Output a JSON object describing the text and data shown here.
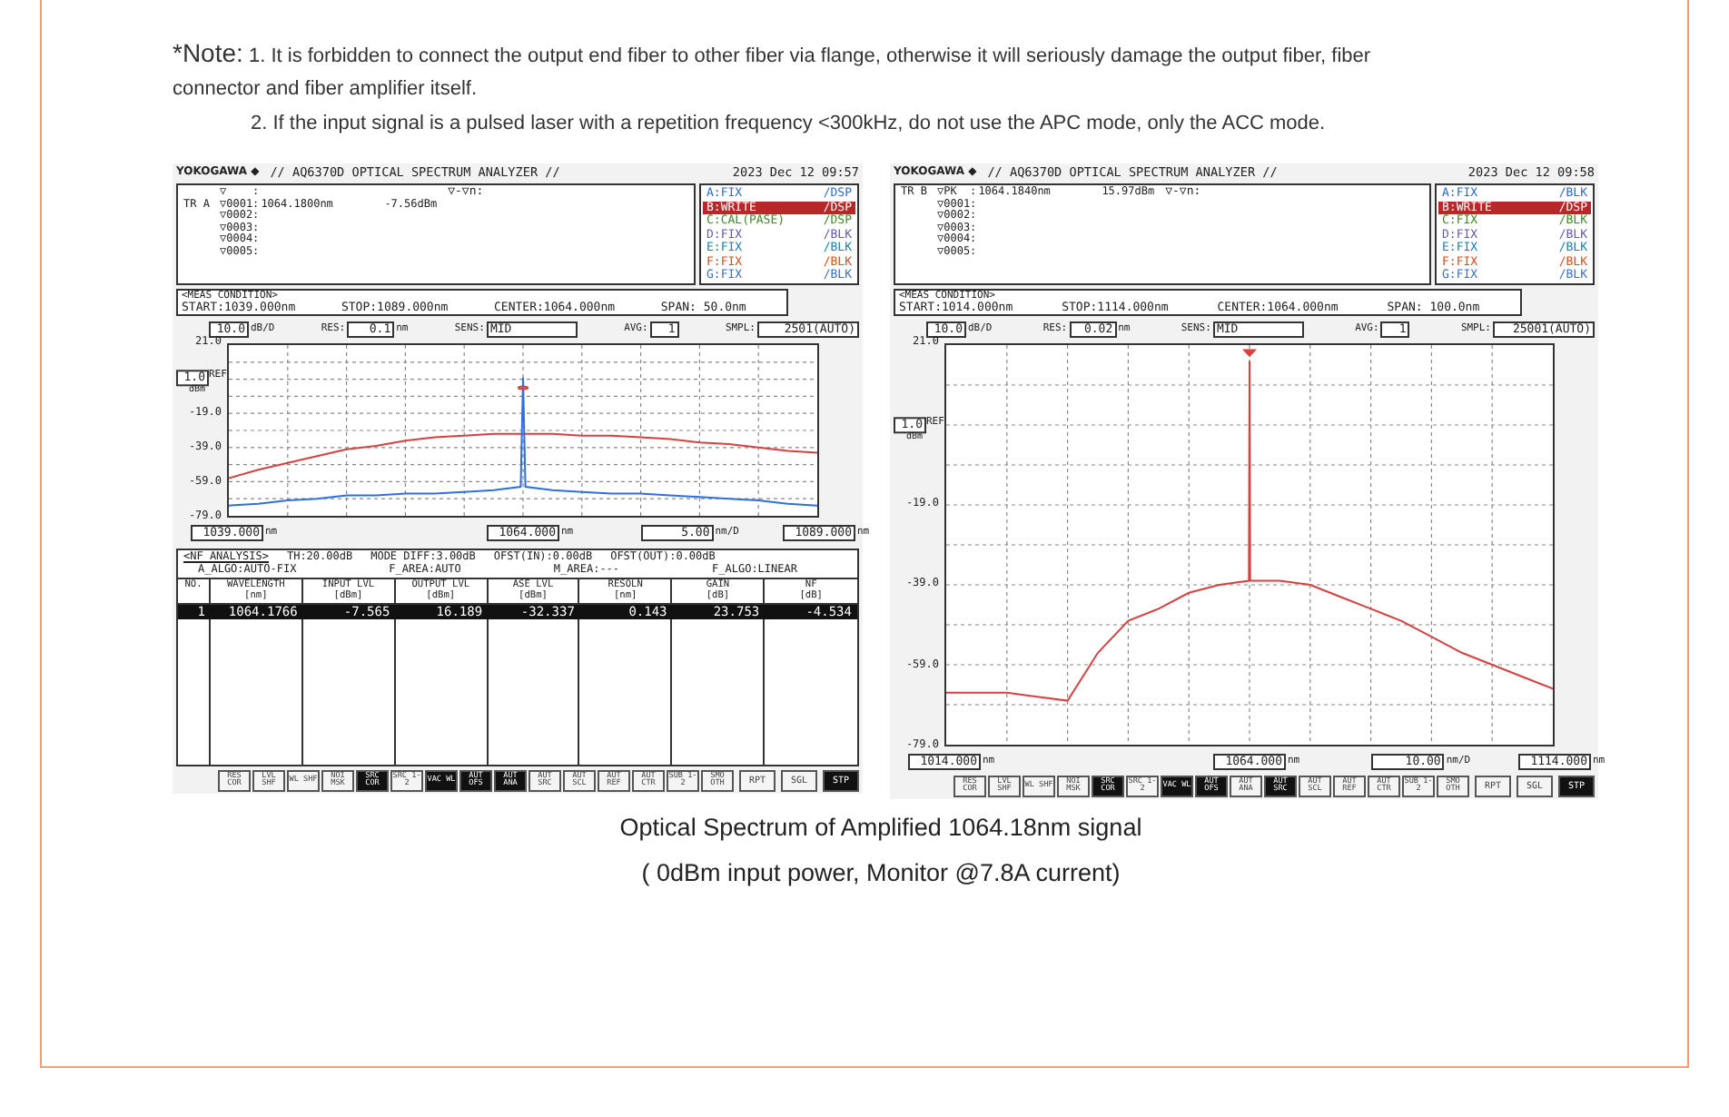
{
  "note": {
    "label": "*Note:",
    "items": [
      "1. It is forbidden to connect the output end fiber to other fiber via flange, otherwise it will seriously damage the output fiber, fiber connector and fiber amplifier itself.",
      "2. If the input signal is a pulsed laser with a repetition frequency <300kHz, do not use the APC mode, only the ACC mode."
    ]
  },
  "analyzers": [
    {
      "kind": "nf",
      "brand": "YOKOGAWA",
      "brand_mark": "◆",
      "model": "// AQ6370D OPTICAL SPECTRUM ANALYZER //",
      "datetime": "2023 Dec 12 09:57",
      "markers": [
        {
          "name": "▽    :"
        },
        {
          "trace": "TR A",
          "name": "▽0001:",
          "wavelength": "1064.1800nm",
          "level_text": "-7.56dBm"
        },
        {
          "name": "▽0002:"
        },
        {
          "name": "▽0003:"
        },
        {
          "name": "▽0004:"
        },
        {
          "name": "▽0005:"
        }
      ],
      "delta": "▽-▽n:",
      "traces": [
        {
          "label": "A:FIX",
          "mode": "/DSP",
          "color": "#2a6ccf",
          "selected": false
        },
        {
          "label": "B:WRITE",
          "mode": "/DSP",
          "color": "#b82828",
          "selected": true
        },
        {
          "label": "C:CAL(PASE)",
          "mode": "/DSP",
          "color": "#3f8a24",
          "selected": false
        },
        {
          "label": "D:FIX",
          "mode": "/BLK",
          "color": "#6a58a8",
          "selected": false
        },
        {
          "label": "E:FIX",
          "mode": "/BLK",
          "color": "#1a7fb4",
          "selected": false
        },
        {
          "label": "F:FIX",
          "mode": "/BLK",
          "color": "#d4501f",
          "selected": false
        },
        {
          "label": "G:FIX",
          "mode": "/BLK",
          "color": "#3f6fc4",
          "selected": false
        }
      ],
      "meas": {
        "title": "<MEAS CONDITION>",
        "start": "START:1039.000nm",
        "stop": "STOP:1089.000nm",
        "center": "CENTER:1064.000nm",
        "span": "SPAN:  50.0nm"
      },
      "settings": {
        "scale": "10.0",
        "scale_unit": "dB/D",
        "res_label": "RES:",
        "res": "0.1",
        "res_unit": "nm",
        "sens_label": "SENS:",
        "sens": "MID",
        "avg_label": "AVG:",
        "avg": "1",
        "smpl_label": "SMPL:",
        "smpl": "2501(AUTO)"
      },
      "ref": {
        "value": "1.0",
        "label": "REF",
        "unit": "dBm"
      },
      "chart_data": {
        "type": "line",
        "yticks": [
          {
            "value": 21,
            "label": "21.0"
          },
          {
            "value": -19,
            "label": "-19.0"
          },
          {
            "value": -39,
            "label": "-39.0"
          },
          {
            "value": -59,
            "label": "-59.0"
          },
          {
            "value": -79,
            "label": "-79.0"
          }
        ],
        "xticks": [
          {
            "value": 1039,
            "label": "1039.000"
          },
          {
            "value": 1064,
            "label": "1064.000"
          },
          {
            "value": 1089,
            "label": "1089.000"
          }
        ],
        "x": [
          1039,
          1041.5,
          1044,
          1046.5,
          1049,
          1051.5,
          1054,
          1056.5,
          1059,
          1061.5,
          1063.8,
          1064,
          1064.2,
          1066.5,
          1069,
          1071.5,
          1074,
          1076.5,
          1079,
          1081.5,
          1084,
          1086.5,
          1089
        ],
        "xlim": [
          1039,
          1089
        ],
        "ylim": [
          -79,
          21
        ],
        "grid": true,
        "series": [
          {
            "color": "#d84040",
            "values": [
              -57,
              -52,
              -48,
              -44,
              -40,
              -38,
              -35,
              -33,
              -32,
              -31,
              -31,
              -31,
              -31,
              -31,
              -32,
              -32,
              -33,
              -34,
              -36,
              -37,
              -39,
              -41,
              -42
            ]
          },
          {
            "color": "#2f6fe0",
            "values": [
              -73,
              -72,
              -70,
              -69,
              -67,
              -67,
              -66,
              -66,
              -65,
              -64,
              -62,
              2,
              -62,
              -64,
              -65,
              -66,
              -66,
              -67,
              -68,
              -69,
              -70,
              -72,
              -73
            ]
          }
        ]
      },
      "xtick_units": [
        "nm",
        "nm",
        "nm"
      ],
      "step": {
        "value": "5.00",
        "unit": "nm/D"
      },
      "analysis": {
        "title": "<NF ANALYSIS>",
        "line1": [
          "TH:20.00dB",
          "MODE DIFF:3.00dB",
          "OFST(IN):0.00dB",
          "OFST(OUT):0.00dB"
        ],
        "line2": [
          "A_ALGO:AUTO-FIX",
          "F_AREA:AUTO",
          "M_AREA:---",
          "F_ALGO:LINEAR"
        ],
        "columns": [
          {
            "name": "NO."
          },
          {
            "name": "WAVELENGTH",
            "unit": "[nm]"
          },
          {
            "name": "INPUT LVL",
            "unit": "[dBm]"
          },
          {
            "name": "OUTPUT LVL",
            "unit": "[dBm]"
          },
          {
            "name": "ASE LVL",
            "unit": "[dBm]"
          },
          {
            "name": "RESOLN",
            "unit": "[nm]"
          },
          {
            "name": "GAIN",
            "unit": "[dB]"
          },
          {
            "name": "NF",
            "unit": "[dB]"
          }
        ],
        "rows": [
          {
            "selected": true,
            "cells": [
              "1",
              "1064.1766",
              "-7.565",
              "16.189",
              "-32.337",
              "0.143",
              "23.753",
              "-4.534"
            ]
          }
        ]
      },
      "keys": [
        {
          "kind": "function",
          "label": "RES COR",
          "on": false
        },
        {
          "kind": "function",
          "label": "LVL SHF",
          "on": false
        },
        {
          "kind": "function",
          "label": "WL SHF",
          "on": false
        },
        {
          "kind": "function",
          "label": "NOI MSK",
          "on": false
        },
        {
          "kind": "function",
          "label": "SRC COR",
          "on": true
        },
        {
          "kind": "function",
          "label": "SRC 1-2",
          "on": false
        },
        {
          "kind": "function",
          "label": "VAC WL",
          "on": true
        },
        {
          "kind": "function",
          "label": "AUT OFS",
          "on": true
        },
        {
          "kind": "function",
          "label": "AUT ANA",
          "on": true
        },
        {
          "kind": "function",
          "label": "AUT SRC",
          "on": false
        },
        {
          "kind": "function",
          "label": "AUT SCL",
          "on": false
        },
        {
          "kind": "function",
          "label": "AUT REF",
          "on": false
        },
        {
          "kind": "function",
          "label": "AUT CTR",
          "on": false
        },
        {
          "kind": "function",
          "label": "SUB 1-2",
          "on": false
        },
        {
          "kind": "function",
          "label": "SMO OTH",
          "on": false
        },
        {
          "kind": "sweep",
          "label": "RPT",
          "on": false
        },
        {
          "kind": "sweep",
          "label": "SGL",
          "on": false
        },
        {
          "kind": "sweep",
          "label": "STP",
          "on": true
        }
      ]
    },
    {
      "kind": "spectrum",
      "brand": "YOKOGAWA",
      "brand_mark": "◆",
      "model": "// AQ6370D OPTICAL SPECTRUM ANALYZER //",
      "datetime": "2023 Dec 12 09:58",
      "markers": [
        {
          "trace": "TR B",
          "name": "▽PK  :",
          "wavelength": "1064.1840nm",
          "level_text": "15.97dBm"
        },
        {
          "name": "▽0001:"
        },
        {
          "name": "▽0002:"
        },
        {
          "name": "▽0003:"
        },
        {
          "name": "▽0004:"
        },
        {
          "name": "▽0005:"
        }
      ],
      "delta": "▽-▽n:",
      "traces": [
        {
          "label": "A:FIX",
          "mode": "/BLK",
          "color": "#2a6ccf",
          "selected": false
        },
        {
          "label": "B:WRITE",
          "mode": "/DSP",
          "color": "#b82828",
          "selected": true
        },
        {
          "label": "C:FIX",
          "mode": "/BLK",
          "color": "#3f8a24",
          "selected": false
        },
        {
          "label": "D:FIX",
          "mode": "/BLK",
          "color": "#6a58a8",
          "selected": false
        },
        {
          "label": "E:FIX",
          "mode": "/BLK",
          "color": "#1a7fb4",
          "selected": false
        },
        {
          "label": "F:FIX",
          "mode": "/BLK",
          "color": "#d4501f",
          "selected": false
        },
        {
          "label": "G:FIX",
          "mode": "/BLK",
          "color": "#3f6fc4",
          "selected": false
        }
      ],
      "meas": {
        "title": "<MEAS CONDITION>",
        "start": "START:1014.000nm",
        "stop": "STOP:1114.000nm",
        "center": "CENTER:1064.000nm",
        "span": "SPAN: 100.0nm"
      },
      "settings": {
        "scale": "10.0",
        "scale_unit": "dB/D",
        "res_label": "RES:",
        "res": "0.02",
        "res_unit": "nm",
        "sens_label": "SENS:",
        "sens": "MID",
        "avg_label": "AVG:",
        "avg": "1",
        "smpl_label": "SMPL:",
        "smpl": "25001(AUTO)"
      },
      "ref": {
        "value": "1.0",
        "label": "REF",
        "unit": "dBm"
      },
      "chart_data": {
        "type": "line",
        "yticks": [
          {
            "value": 21,
            "label": "21.0"
          },
          {
            "value": -19,
            "label": "-19.0"
          },
          {
            "value": -39,
            "label": "-39.0"
          },
          {
            "value": -59,
            "label": "-59.0"
          },
          {
            "value": -79,
            "label": "-79.0"
          }
        ],
        "xticks": [
          {
            "value": 1014,
            "label": "1014.000"
          },
          {
            "value": 1064,
            "label": "1064.000"
          },
          {
            "value": 1114,
            "label": "1114.000"
          }
        ],
        "x": [
          1014,
          1019,
          1024,
          1029,
          1034,
          1039,
          1044,
          1049,
          1054,
          1059,
          1063.9,
          1064,
          1064.1,
          1069,
          1074,
          1079,
          1084,
          1089,
          1094,
          1099,
          1104,
          1109,
          1114
        ],
        "xlim": [
          1014,
          1114
        ],
        "ylim": [
          -79,
          21
        ],
        "grid": true,
        "series": [
          {
            "color": "#d84040",
            "values": [
              -66,
              -66,
              -66,
              -67,
              -68,
              -56,
              -48,
              -45,
              -41,
              -39,
              -38,
              17,
              -38,
              -38,
              -39,
              -42,
              -45,
              -48,
              -52,
              -56,
              -59,
              -62,
              -65
            ]
          }
        ]
      },
      "xtick_units": [
        "nm",
        "nm",
        "nm"
      ],
      "step": {
        "value": "10.00",
        "unit": "nm/D"
      },
      "keys": [
        {
          "kind": "function",
          "label": "RES COR",
          "on": false
        },
        {
          "kind": "function",
          "label": "LVL SHF",
          "on": false
        },
        {
          "kind": "function",
          "label": "WL SHF",
          "on": false
        },
        {
          "kind": "function",
          "label": "NOI MSK",
          "on": false
        },
        {
          "kind": "function",
          "label": "SRC COR",
          "on": true
        },
        {
          "kind": "function",
          "label": "SRC 1-2",
          "on": false
        },
        {
          "kind": "function",
          "label": "VAC WL",
          "on": true
        },
        {
          "kind": "function",
          "label": "AUT OFS",
          "on": true
        },
        {
          "kind": "function",
          "label": "AUT ANA",
          "on": false
        },
        {
          "kind": "function",
          "label": "AUT SRC",
          "on": true
        },
        {
          "kind": "function",
          "label": "AUT SCL",
          "on": false
        },
        {
          "kind": "function",
          "label": "AUT REF",
          "on": false
        },
        {
          "kind": "function",
          "label": "AUT CTR",
          "on": false
        },
        {
          "kind": "function",
          "label": "SUB 1-2",
          "on": false
        },
        {
          "kind": "function",
          "label": "SMO OTH",
          "on": false
        },
        {
          "kind": "sweep",
          "label": "RPT",
          "on": false
        },
        {
          "kind": "sweep",
          "label": "SGL",
          "on": false
        },
        {
          "kind": "sweep",
          "label": "STP",
          "on": true
        }
      ]
    }
  ],
  "caption": [
    "Optical Spectrum of Amplified 1064.18nm signal",
    "( 0dBm input power, Monitor @7.8A current)"
  ]
}
